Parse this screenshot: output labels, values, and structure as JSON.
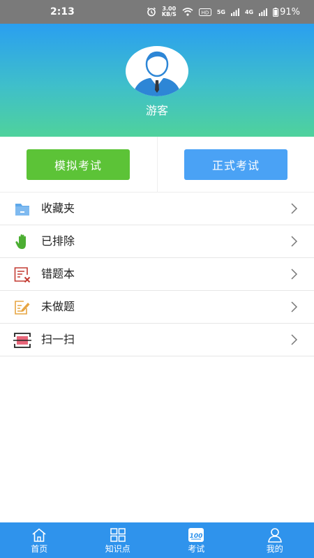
{
  "status_bar": {
    "time": "2:13",
    "net_speed_value": "3.00",
    "net_speed_unit": "KB/S",
    "network_5g": "5G",
    "network_4g": "4G",
    "battery": "91%"
  },
  "profile": {
    "username": "游客"
  },
  "exam_buttons": {
    "mock_label": "模拟考试",
    "formal_label": "正式考试"
  },
  "menu": {
    "items": [
      {
        "label": "收藏夹",
        "icon": "folder-icon"
      },
      {
        "label": "已排除",
        "icon": "hand-icon"
      },
      {
        "label": "错题本",
        "icon": "wrong-list-icon"
      },
      {
        "label": "未做题",
        "icon": "edit-note-icon"
      },
      {
        "label": "扫一扫",
        "icon": "scan-icon"
      }
    ]
  },
  "tab_bar": {
    "tabs": [
      {
        "label": "首页",
        "icon": "home-icon"
      },
      {
        "label": "知识点",
        "icon": "grid-icon"
      },
      {
        "label": "考试",
        "icon": "exam-icon",
        "active": true
      },
      {
        "label": "我的",
        "icon": "person-icon"
      }
    ]
  },
  "colors": {
    "header_gradient_top": "#2a9ff0",
    "header_gradient_bottom": "#4fd29c",
    "mock_button": "#5cc337",
    "formal_button": "#4aa2f5",
    "tab_bar": "#2f93ec"
  }
}
